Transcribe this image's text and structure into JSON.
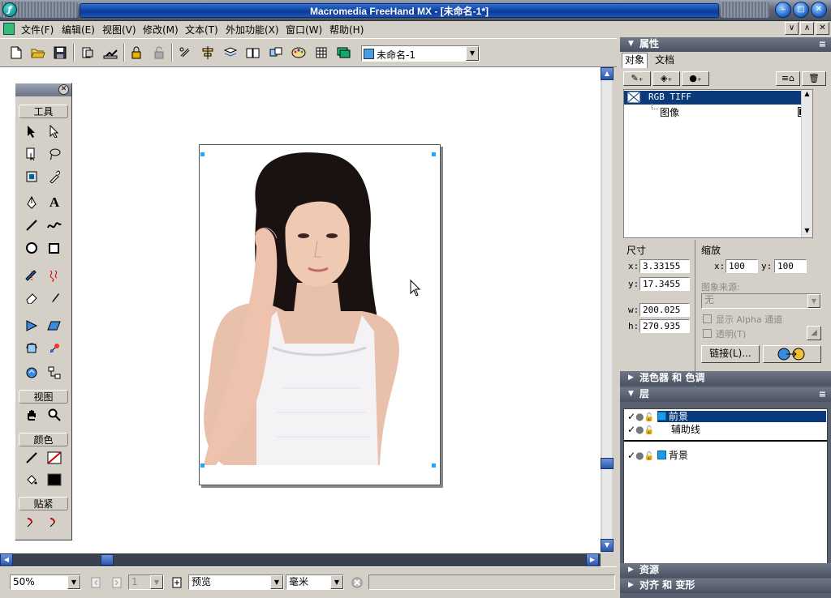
{
  "window": {
    "title": "Macromedia FreeHand MX - [未命名-1*]",
    "app_icon": "freehand-logo",
    "controls": [
      "minimize",
      "maximize",
      "close"
    ],
    "mdi_controls": [
      "∨",
      "∧",
      "✕"
    ]
  },
  "menu": {
    "items": [
      "文件(F)",
      "编辑(E)",
      "视图(V)",
      "修改(M)",
      "文本(T)",
      "外加功能(X)",
      "窗口(W)",
      "帮助(H)"
    ]
  },
  "toolbar": {
    "document_select": "未命名-1"
  },
  "tools_panel": {
    "sections": {
      "tools": "工具",
      "view": "视图",
      "colors": "颜色",
      "snap": "贴紧"
    }
  },
  "properties": {
    "title": "属性",
    "tabs": [
      "对象",
      "文档"
    ],
    "object_list": {
      "selected": "RGB TIFF",
      "child": "图像"
    },
    "size_label": "尺寸",
    "scale_label": "缩放",
    "x": "3.33155",
    "y": "17.3455",
    "w": "200.025",
    "h": "270.935",
    "scale_x": "100",
    "scale_y": "100",
    "image_source_label": "图象来源:",
    "image_source_value": "无",
    "show_alpha_label": "显示 Alpha 通道",
    "transparent_label": "透明(T)",
    "link_button": "链接(L)..."
  },
  "panels": {
    "mixer": "混色器 和 色调",
    "layers": "层",
    "assets": "资源",
    "align": "对齐 和 变形"
  },
  "layers": [
    {
      "name": "前景",
      "selected": true
    },
    {
      "name": "辅助线",
      "selected": false
    },
    {
      "name": "背景",
      "selected": false
    }
  ],
  "statusbar": {
    "zoom": "50%",
    "page": "1",
    "display_mode": "预览",
    "units": "毫米"
  },
  "canvas": {
    "image_alt": "photo of a young woman in white camisole"
  }
}
